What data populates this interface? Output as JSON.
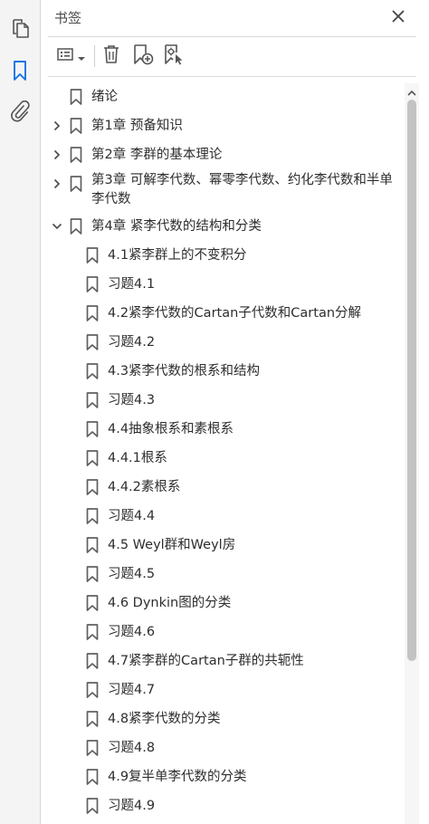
{
  "panel": {
    "title": "书签"
  },
  "rail": {
    "items": [
      {
        "name": "pages-icon"
      },
      {
        "name": "bookmarks-icon"
      },
      {
        "name": "attachments-icon"
      }
    ],
    "active_color": "#1473e6"
  },
  "toolbar": {
    "buttons": [
      "options-menu",
      "delete-bookmark",
      "new-bookmark",
      "new-bookmark-from-structure"
    ]
  },
  "bookmarks": [
    {
      "label": "绪论",
      "level": 0,
      "expander": "none"
    },
    {
      "label": "第1章  预备知识",
      "level": 0,
      "expander": "collapsed"
    },
    {
      "label": "第2章  李群的基本理论",
      "level": 0,
      "expander": "collapsed"
    },
    {
      "label": "第3章  可解李代数、幂零李代数、约化李代数和半单李代数",
      "level": 0,
      "expander": "collapsed"
    },
    {
      "label": "第4章  紧李代数的结构和分类",
      "level": 0,
      "expander": "expanded"
    },
    {
      "label": "4.1紧李群上的不变积分",
      "level": 1,
      "expander": "none"
    },
    {
      "label": "习题4.1",
      "level": 1,
      "expander": "none"
    },
    {
      "label": "4.2紧李代数的Cartan子代数和Cartan分解",
      "level": 1,
      "expander": "none"
    },
    {
      "label": "习题4.2",
      "level": 1,
      "expander": "none"
    },
    {
      "label": "4.3紧李代数的根系和结构",
      "level": 1,
      "expander": "none"
    },
    {
      "label": "习题4.3",
      "level": 1,
      "expander": "none"
    },
    {
      "label": "4.4抽象根系和素根系",
      "level": 1,
      "expander": "none"
    },
    {
      "label": "4.4.1根系",
      "level": 1,
      "expander": "none"
    },
    {
      "label": "4.4.2素根系",
      "level": 1,
      "expander": "none"
    },
    {
      "label": "习题4.4",
      "level": 1,
      "expander": "none"
    },
    {
      "label": "4.5  Weyl群和Weyl房",
      "level": 1,
      "expander": "none"
    },
    {
      "label": "习题4.5",
      "level": 1,
      "expander": "none"
    },
    {
      "label": "4.6  Dynkin图的分类",
      "level": 1,
      "expander": "none"
    },
    {
      "label": "习题4.6",
      "level": 1,
      "expander": "none"
    },
    {
      "label": "4.7紧李群的Cartan子群的共轭性",
      "level": 1,
      "expander": "none"
    },
    {
      "label": "习题4.7",
      "level": 1,
      "expander": "none"
    },
    {
      "label": "4.8紧李代数的分类",
      "level": 1,
      "expander": "none"
    },
    {
      "label": "习题4.8",
      "level": 1,
      "expander": "none"
    },
    {
      "label": "4.9复半单李代数的分类",
      "level": 1,
      "expander": "none"
    },
    {
      "label": "习题4.9",
      "level": 1,
      "expander": "none"
    }
  ]
}
